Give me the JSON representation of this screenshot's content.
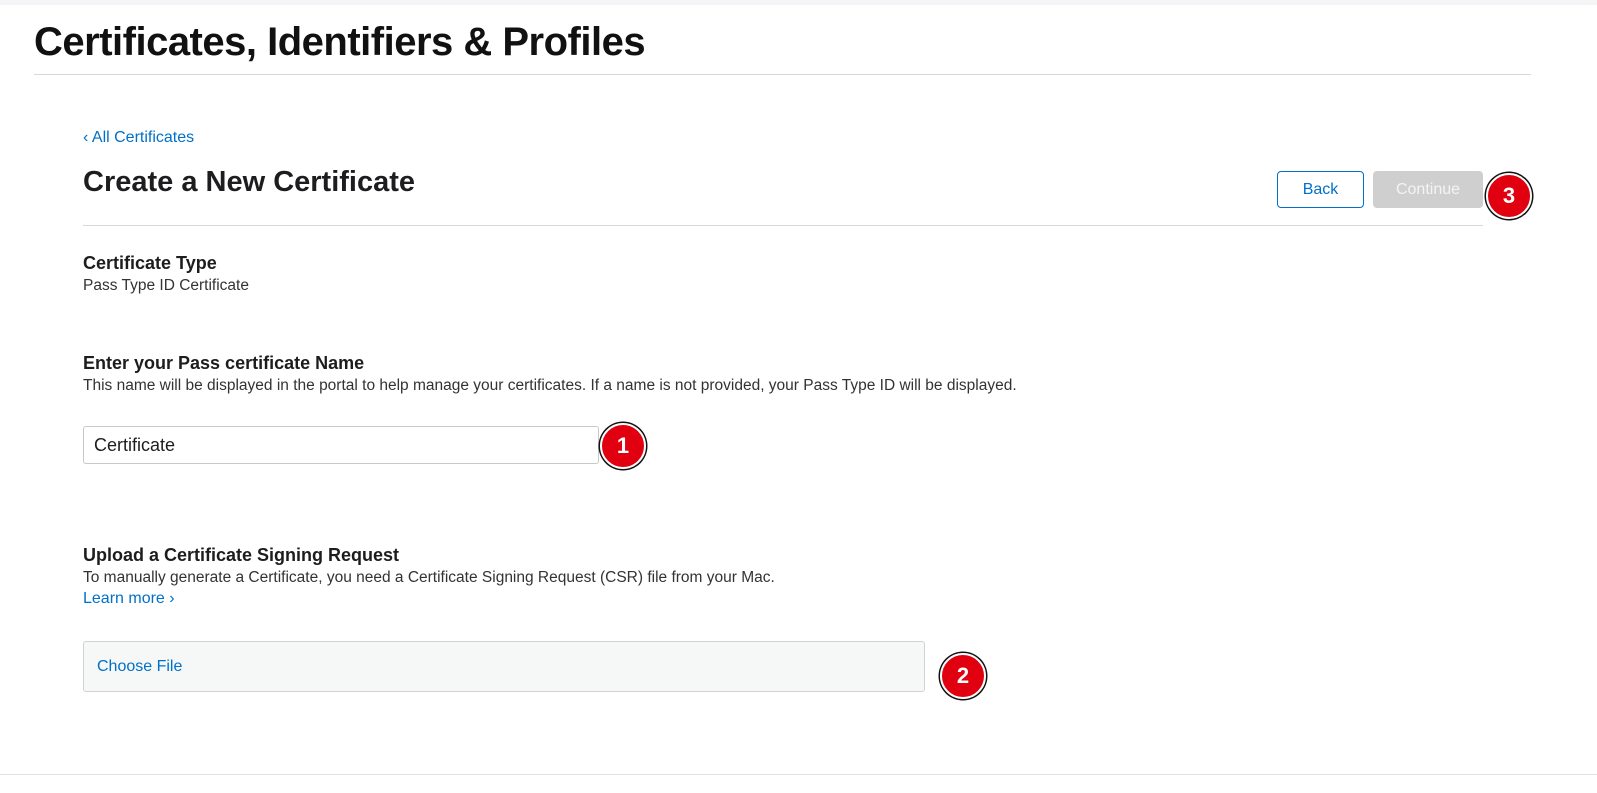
{
  "header": {
    "title": "Certificates, Identifiers & Profiles"
  },
  "breadcrumb": {
    "label": "‹ All Certificates"
  },
  "section": {
    "title": "Create a New Certificate",
    "back_label": "Back",
    "continue_label": "Continue"
  },
  "certificate_type": {
    "label": "Certificate Type",
    "value": "Pass Type ID Certificate"
  },
  "name_field": {
    "label": "Enter your Pass certificate Name",
    "help": "This name will be displayed in the portal to help manage your certificates. If a name is not provided, your Pass Type ID will be displayed.",
    "value": "Certificate"
  },
  "csr_upload": {
    "label": "Upload a Certificate Signing Request",
    "help": "To manually generate a Certificate, you need a Certificate Signing Request (CSR) file from your Mac.",
    "learn_more": "Learn more ›",
    "choose_file": "Choose File"
  },
  "markers": {
    "name_field": "1",
    "file_upload": "2",
    "continue": "3"
  },
  "colors": {
    "link": "#0070c9",
    "marker": "#e00010",
    "disabled_button": "#cfcfcf"
  }
}
